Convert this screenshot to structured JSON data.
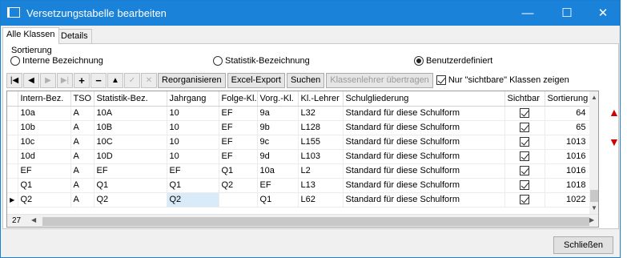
{
  "window": {
    "title": "Versetzungstabelle bearbeiten",
    "minimize": "—",
    "maximize": "☐",
    "close": "✕"
  },
  "tabs": [
    {
      "label": "Alle Klassen",
      "active": true
    },
    {
      "label": "Details",
      "active": false
    }
  ],
  "sort": {
    "group_label": "Sortierung",
    "options": [
      {
        "label": "Interne Bezeichnung",
        "selected": false
      },
      {
        "label": "Statistik-Bezeichnung",
        "selected": false
      },
      {
        "label": "Benutzerdefiniert",
        "selected": true
      }
    ]
  },
  "toolbar": {
    "nav_icons": [
      "first-record-icon",
      "prior-record-icon",
      "next-record-icon",
      "last-record-icon",
      "add-icon",
      "delete-icon",
      "move-up-icon",
      "check-icon",
      "cancel-icon"
    ],
    "buttons": {
      "reorganize": "Reorganisieren",
      "excel_export": "Excel-Export",
      "search": "Suchen",
      "class_teacher": "Klassenlehrer übertragen"
    },
    "visible_only_label": "Nur \"sichtbare\" Klassen zeigen",
    "visible_only_checked": true
  },
  "table": {
    "columns": [
      "Intern-Bez.",
      "TSO",
      "Statistik-Bez.",
      "Jahrgang",
      "Folge-Kl.",
      "Vorg.-Kl.",
      "Kl.-Lehrer",
      "Schulgliederung",
      "Sichtbar",
      "Sortierung"
    ],
    "rows": [
      {
        "cells": [
          "10a",
          "A",
          "10A",
          "10",
          "EF",
          "9a",
          "L32",
          "Standard für diese Schulform",
          "",
          "64"
        ],
        "current": false
      },
      {
        "cells": [
          "10b",
          "A",
          "10B",
          "10",
          "EF",
          "9b",
          "L128",
          "Standard für diese Schulform",
          "",
          "65"
        ],
        "current": false
      },
      {
        "cells": [
          "10c",
          "A",
          "10C",
          "10",
          "EF",
          "9c",
          "L155",
          "Standard für diese Schulform",
          "",
          "1013"
        ],
        "current": false
      },
      {
        "cells": [
          "10d",
          "A",
          "10D",
          "10",
          "EF",
          "9d",
          "L103",
          "Standard für diese Schulform",
          "",
          "1016"
        ],
        "current": false
      },
      {
        "cells": [
          "EF",
          "A",
          "EF",
          "EF",
          "Q1",
          "10a",
          "L2",
          "Standard für diese Schulform",
          "",
          "1016"
        ],
        "current": false
      },
      {
        "cells": [
          "Q1",
          "A",
          "Q1",
          "Q1",
          "Q2",
          "EF",
          "L13",
          "Standard für diese Schulform",
          "",
          "1018"
        ],
        "current": false
      },
      {
        "cells": [
          "Q2",
          "A",
          "Q2",
          "Q2",
          "",
          "Q1",
          "L62",
          "Standard für diese Schulform",
          "",
          "1022"
        ],
        "current": true
      }
    ],
    "record_count": "27"
  },
  "footer": {
    "close_label": "Schließen"
  },
  "colors": {
    "titlebar": "#1a82d8",
    "selection": "#d9eaf8",
    "move_arrows": "#d00000"
  }
}
